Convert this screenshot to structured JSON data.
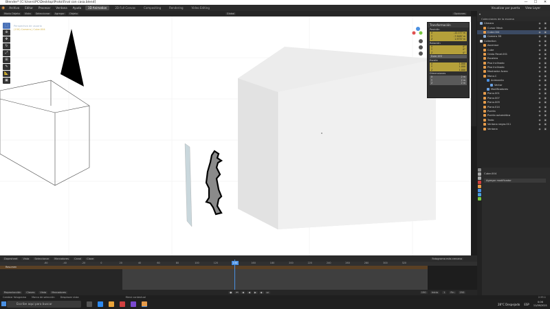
{
  "window": {
    "title": "Blender* [C:\\Users\\PC\\Desktop\\Proto\\Final con casa.blend]",
    "controls": [
      "—",
      "☐",
      "✕"
    ]
  },
  "menu": {
    "items": [
      "Archivo",
      "Editar",
      "Procesar",
      "Ventana",
      "Ayuda"
    ],
    "workspaces": [
      "3D Animation",
      "2D Full Canvas",
      "Compositing",
      "Rendering",
      "Video Editing"
    ],
    "active_workspace": "3D Animation",
    "scene_label": "Visualizar por puerta",
    "view_layer": "View Layer"
  },
  "viewport_header": {
    "mode": "Modo Objeto",
    "menus": [
      "Vista",
      "Seleccionar",
      "Agregar",
      "Objeto"
    ],
    "orientation": "Global",
    "options": "Opciones"
  },
  "viewport": {
    "info_line1": "Perspectiva de usuario",
    "info_line2": "(150) Camera | Cube.004"
  },
  "npanel": {
    "header": "Transformación",
    "position_label": "Posición",
    "position": [
      {
        "axis": "X",
        "value": "-12.177 m"
      },
      {
        "axis": "Y",
        "value": "-7.5087 m"
      },
      {
        "axis": "Z",
        "value": "1.9737 m"
      }
    ],
    "rotation_label": "Rotación",
    "rotation": [
      {
        "axis": "X",
        "value": "0°"
      },
      {
        "axis": "Y",
        "value": "0°"
      },
      {
        "axis": "Z",
        "value": "0°"
      }
    ],
    "rotation_mode": "Euler XYZ",
    "scale_label": "Escala",
    "scale": [
      {
        "axis": "X",
        "value": "1.000"
      },
      {
        "axis": "Y",
        "value": "1.000"
      },
      {
        "axis": "Z",
        "value": "1.000"
      }
    ],
    "dimensions_label": "Dimensiones",
    "dimensions": [
      {
        "axis": "X",
        "value": "2 m"
      },
      {
        "axis": "Y",
        "value": "2 m"
      },
      {
        "axis": "Z",
        "value": "2 m"
      }
    ]
  },
  "outliner": {
    "collection_title": "Colecciones de la escena",
    "items": [
      {
        "label": "Cámara",
        "color": "#8fb0d8",
        "indent": 0
      },
      {
        "label": "Cursor Mesh",
        "color": "#e59b4a",
        "indent": 1
      },
      {
        "label": "Cube.004",
        "color": "#e59b4a",
        "indent": 1
      },
      {
        "label": "Camera 3D",
        "color": "#8fb0d8",
        "indent": 1
      },
      {
        "label": "Collection",
        "color": "#ddd",
        "indent": 0
      },
      {
        "label": "Ascensor",
        "color": "#e59b4a",
        "indent": 1
      },
      {
        "label": "Cube",
        "color": "#e59b4a",
        "indent": 1
      },
      {
        "label": "Cesto Panel.001",
        "color": "#e59b4a",
        "indent": 1
      },
      {
        "label": "Escalera",
        "color": "#e59b4a",
        "indent": 1
      },
      {
        "label": "Piso Inclinado",
        "color": "#e59b4a",
        "indent": 1
      },
      {
        "label": "Piso Inclinado",
        "color": "#e59b4a",
        "indent": 1
      },
      {
        "label": "Mostrador Acero",
        "color": "#e59b4a",
        "indent": 1
      },
      {
        "label": "Mono.C",
        "color": "#e59b4a",
        "indent": 1
      },
      {
        "label": "Animación",
        "color": "#4a90e2",
        "indent": 2
      },
      {
        "label": "Vector",
        "color": "#6aa0e0",
        "indent": 3
      },
      {
        "label": "Modificadores",
        "color": "#6aa0e0",
        "indent": 2
      },
      {
        "label": "Plano.001",
        "color": "#e59b4a",
        "indent": 1
      },
      {
        "label": "Plano.007",
        "color": "#e59b4a",
        "indent": 1
      },
      {
        "label": "Plano.009",
        "color": "#e59b4a",
        "indent": 1
      },
      {
        "label": "Plano.014",
        "color": "#e59b4a",
        "indent": 1
      },
      {
        "label": "Puerta",
        "color": "#e59b4a",
        "indent": 1
      },
      {
        "label": "Puerta automática",
        "color": "#e59b4a",
        "indent": 1
      },
      {
        "label": "Texto",
        "color": "#e59b4a",
        "indent": 1
      },
      {
        "label": "Ventana negro.011",
        "color": "#e59b4a",
        "indent": 1
      },
      {
        "label": "Ventana",
        "color": "#e59b4a",
        "indent": 1
      }
    ]
  },
  "properties": {
    "object_name": "Cube.004",
    "add_modifier": "Agregar modificador"
  },
  "timeline": {
    "menus": [
      "Reproducción",
      "Claves",
      "Vista",
      "Marcadores"
    ],
    "top_menus": [
      "Dopesheet",
      "Vista",
      "Seleccionar",
      "Marcadores",
      "Canal",
      "Clave"
    ],
    "summary_label": "Resumen",
    "current_frame": "150",
    "start": "Inicio",
    "start_value": "1",
    "end": "Fin",
    "end_value": "250",
    "fps_value": "150",
    "ticks": [
      "-60",
      "-40",
      "-20",
      "0",
      "20",
      "40",
      "60",
      "80",
      "100",
      "120",
      "140",
      "160",
      "180",
      "200",
      "220",
      "240",
      "260",
      "280",
      "300",
      "320"
    ],
    "key_mode": "Fotograma más cercano"
  },
  "status": {
    "items": [
      "Cambiar fotograma",
      "Marco de selección",
      "Desplazar vista",
      "Menú contextual"
    ],
    "version": "2.93.1"
  },
  "taskbar": {
    "search_placeholder": "Escribe aquí para buscar",
    "weather": "28°C Despejado",
    "time": "0:06",
    "date": "11/09/2021",
    "language": "ESP"
  },
  "colors": {
    "accent": "#4a90e2",
    "selected": "#d4b34a",
    "field_yellow": "#b5a03a",
    "object_orange": "#e59b4a"
  }
}
